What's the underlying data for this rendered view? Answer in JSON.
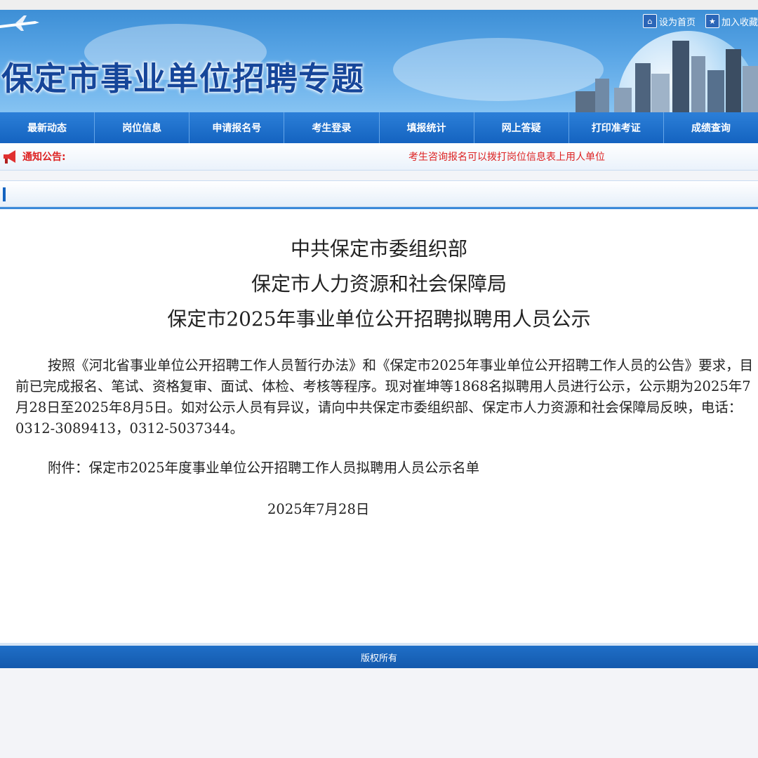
{
  "header": {
    "title": "保定市事业单位招聘专题",
    "links": [
      {
        "icon": "home-icon",
        "label": "设为首页"
      },
      {
        "icon": "star-icon",
        "label": "加入收藏"
      }
    ]
  },
  "nav": {
    "items": [
      "最新动态",
      "岗位信息",
      "申请报名号",
      "考生登录",
      "填报统计",
      "网上答疑",
      "打印准考证",
      "成绩查询"
    ]
  },
  "notice": {
    "icon": "megaphone-icon",
    "label": "通知公告:",
    "text": "考生咨询报名可以拨打岗位信息表上用人单位"
  },
  "article": {
    "heading_lines": [
      "中共保定市委组织部",
      "保定市人力资源和社会保障局",
      "保定市2025年事业单位公开招聘拟聘用人员公示"
    ],
    "body": "按照《河北省事业单位公开招聘工作人员暂行办法》和《保定市2025年事业单位公开招聘工作人员的公告》要求，目前已完成报名、笔试、资格复审、面试、体检、考核等程序。现对崔坤等1868名拟聘用人员进行公示，公示期为2025年7月28日至2025年8月5日。如对公示人员有异议，请向中共保定市委组织部、保定市人力资源和社会保障局反映，电话：0312-3089413，0312-5037344。",
    "attachment": "附件：保定市2025年度事业单位公开招聘工作人员拟聘用人员公示名单",
    "date": "2025年7月28日"
  },
  "footer": {
    "copyright": "版权所有"
  },
  "colors": {
    "nav": "#1463c0",
    "notice_text": "#dd2222",
    "title": "#16469a"
  }
}
